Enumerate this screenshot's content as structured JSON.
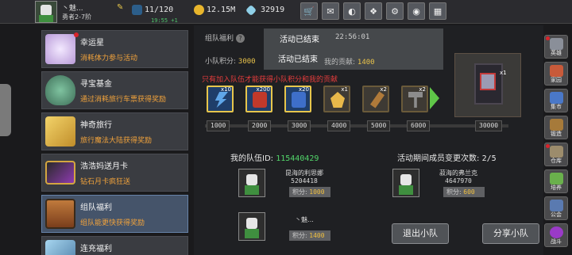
{
  "player": {
    "name": "丶魅...",
    "rank": "勇者2-7阶"
  },
  "stats": {
    "energy": "11/120",
    "regen": "19:55 +1",
    "gold": "12.15M",
    "gems": "32919"
  },
  "top_buttons": [
    "shop-icon",
    "mail-icon",
    "gamepad-icon",
    "gift-icon",
    "settings-icon",
    "color-wheel-icon",
    "events-icon"
  ],
  "menu": {
    "items": [
      {
        "title": "幸运星",
        "sub": "消耗体力参与活动",
        "color": "#c9b4e8",
        "dot": true
      },
      {
        "title": "寻宝基金",
        "sub": "通过消耗旅行车票获得奖励",
        "color": "#5a9a7a",
        "dot": false
      },
      {
        "title": "神奇旅行",
        "sub": "旅行魔法大陆获得奖励",
        "color": "#e2c048",
        "dot": false
      },
      {
        "title": "浩浩妈送月卡",
        "sub": "钻石月卡疯狂送",
        "color": "#8e3bb0",
        "dot": false
      },
      {
        "title": "组队福利",
        "sub": "组队能更快获得奖励",
        "color": "#b3642c",
        "dot": false
      },
      {
        "title": "连充福利",
        "sub": "",
        "color": "#7eb0d6",
        "dot": false
      }
    ]
  },
  "main": {
    "header_label": "组队福利",
    "team_score_label": "小队积分:",
    "team_score": "3000",
    "overlay_ended": "活动已结束",
    "overlay_time": "22:56:01",
    "my_contrib_label": "我的贡献:",
    "my_contrib": "1400",
    "notice": "只有加入队伍才能获得小队积分和我的贡献",
    "rewards": [
      {
        "qty": "x10",
        "color": "#5fa6e8"
      },
      {
        "qty": "x200",
        "color": "#c0392b"
      },
      {
        "qty": "x20",
        "color": "#3e6fc9"
      },
      {
        "qty": "x1",
        "color": "#e8b84a"
      },
      {
        "qty": "x2",
        "color": "#b07a3a"
      },
      {
        "qty": "x2",
        "color": "#8c8c8c"
      }
    ],
    "preview_qty": "x1",
    "progress_ticks": [
      "1000",
      "2000",
      "3000",
      "4000",
      "5000",
      "6000",
      "30000"
    ],
    "team_id_label": "我的队伍ID:",
    "team_id": "115440429",
    "changes_label": "活动期间成员变更次数:",
    "changes": "2/5",
    "members": [
      {
        "name": "昆海的利思娜",
        "id": "5204418",
        "score_label": "积分:",
        "score": "1000"
      },
      {
        "name": "菽海的弗兰克",
        "id": "4647970",
        "score_label": "积分:",
        "score": "600"
      },
      {
        "name": "丶魅...",
        "id": "",
        "score_label": "积分:",
        "score": "1400"
      }
    ],
    "leave_btn": "退出小队",
    "share_btn": "分享小队"
  },
  "side": [
    {
      "label": "英雄",
      "color": "#8a8f99",
      "dot": true
    },
    {
      "label": "家园",
      "color": "#c85a3a",
      "dot": false
    },
    {
      "label": "集市",
      "color": "#4a78c8",
      "dot": false
    },
    {
      "label": "锻造",
      "color": "#a67a3a",
      "dot": false
    },
    {
      "label": "仓库",
      "color": "#9c8c6c",
      "dot": true
    },
    {
      "label": "培养",
      "color": "#6ab04c",
      "dot": false
    },
    {
      "label": "公会",
      "color": "#5a7ab0",
      "dot": false
    },
    {
      "label": "战斗",
      "color": "#9a3ac8",
      "dot": false
    }
  ]
}
